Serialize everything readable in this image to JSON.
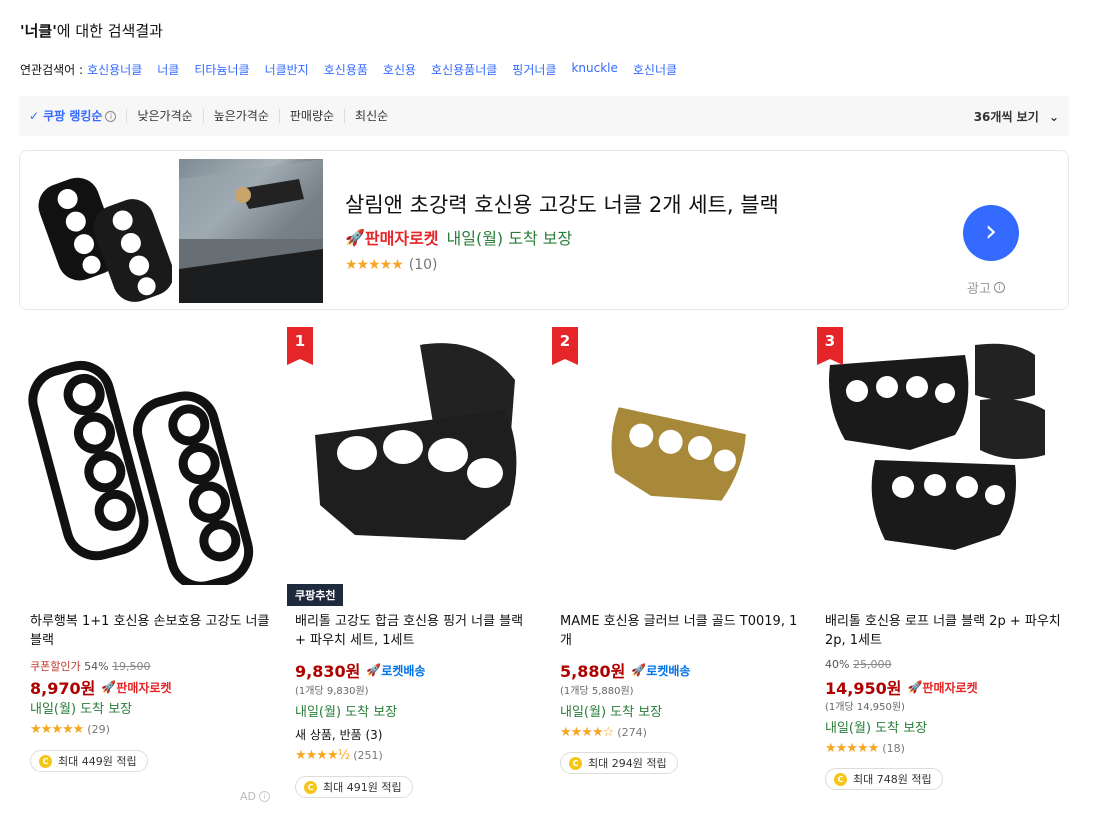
{
  "search": {
    "keyword": "'너클'",
    "suffix": "에 대한 검색결과"
  },
  "related": {
    "label": "연관검색어 :",
    "keywords": [
      "호신용너클",
      "너클",
      "티타늄너클",
      "너클반지",
      "호신용품",
      "호신용",
      "호신용품너클",
      "핑거너클",
      "knuckle",
      "호신너클"
    ]
  },
  "sort": {
    "items": [
      "쿠팡 랭킹순",
      "낮은가격순",
      "높은가격순",
      "판매량순",
      "최신순"
    ],
    "view_count": "36개씩 보기"
  },
  "ad": {
    "title": "살림앤 초강력 호신용 고강도 너클 2개 세트, 블랙",
    "rocket": "판매자로켓",
    "arrival": "내일(월) 도착 보장",
    "stars": "★★★★★",
    "reviews": "(10)",
    "label": "광고",
    "arrow": "›"
  },
  "products": [
    {
      "rank": "",
      "name": "하루행복 1+1 호신용 손보호용 고강도 너클 블랙",
      "coupon": "쿠폰할인가",
      "discount": "54%",
      "original": "19,500",
      "price": "8,970원",
      "tag": "판매자로켓",
      "unit": "",
      "arrival": "내일(월) 도착 보장",
      "new_item": "",
      "stars": "★★★★★",
      "reviews": "(29)",
      "points": "최대 449원 적립"
    },
    {
      "rank": "1",
      "badge": "쿠팡추천",
      "name": "배리톨 고강도 합금 호신용 핑거 너클 블랙 + 파우치 세트, 1세트",
      "price": "9,830원",
      "tag": "로켓배송",
      "unit": "(1개당 9,830원)",
      "arrival": "내일(월) 도착 보장",
      "new_item": "새 상품, 반품 (3)",
      "stars": "★★★★½",
      "reviews": "(251)",
      "points": "최대 491원 적립"
    },
    {
      "rank": "2",
      "name": "MAME 호신용 글러브 너클 골드 T0019, 1개",
      "price": "5,880원",
      "tag": "로켓배송",
      "unit": "(1개당 5,880원)",
      "arrival": "내일(월) 도착 보장",
      "stars": "★★★★☆",
      "reviews": "(274)",
      "points": "최대 294원 적립"
    },
    {
      "rank": "3",
      "name": "배리톨 호신용 로프 너클 블랙 2p + 파우치 2p, 1세트",
      "discount": "40%",
      "original": "25,000",
      "price": "14,950원",
      "tag": "판매자로켓",
      "unit": "(1개당 14,950원)",
      "arrival": "내일(월) 도착 보장",
      "stars": "★★★★★",
      "reviews": "(18)",
      "points": "최대 748원 적립"
    }
  ],
  "ad_small": "AD",
  "colors": {
    "accent": "#346aff",
    "price": "#ae0000",
    "rocket_seller": "#e52528",
    "rocket_delivery": "#0073e9",
    "arrival": "#2a7d3a",
    "star": "#f5a623"
  }
}
